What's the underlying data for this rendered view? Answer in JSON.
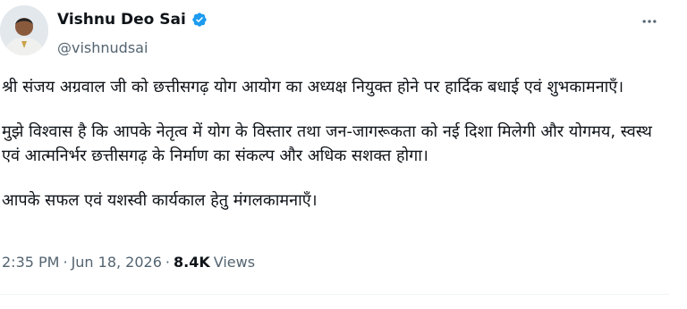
{
  "author": {
    "name": "Vishnu Deo Sai",
    "handle": "@vishnudsai",
    "verified_color": "#1d9bf0"
  },
  "tweet": {
    "paragraphs": [
      "श्री संजय अग्रवाल जी को छत्तीसगढ़ योग आयोग का अध्यक्ष नियुक्त होने पर हार्दिक बधाई एवं शुभकामनाएँ।",
      "मुझे विश्वास है कि आपके नेतृत्व में योग के विस्तार तथा जन-जागरूकता को नई दिशा मिलेगी और योगमय, स्वस्थ एवं आत्मनिर्भर छत्तीसगढ़ के निर्माण का संकल्प और अधिक सशक्त होगा।",
      "आपके सफल एवं यशस्वी कार्यकाल हेतु मंगलकामनाएँ।"
    ]
  },
  "meta": {
    "time": "2:35 PM",
    "separator": "·",
    "date": "Jun 18, 2026",
    "views_count": "8.4K",
    "views_label": "Views"
  },
  "icons": {
    "avatar": "profile-photo",
    "verified": "verified-badge-icon",
    "more": "more-options-icon"
  }
}
